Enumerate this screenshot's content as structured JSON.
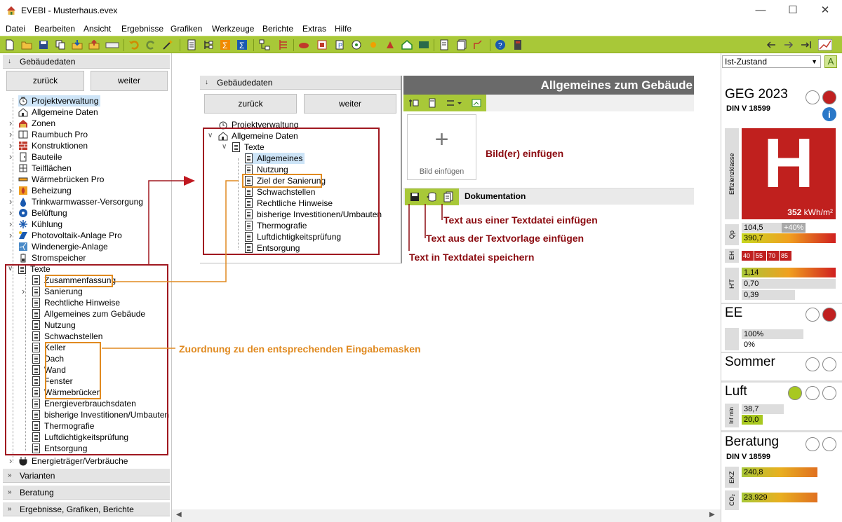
{
  "window": {
    "title": "EVEBI - Musterhaus.evex"
  },
  "menu": [
    "Datei",
    "Bearbeiten",
    "Ansicht",
    "Ergebnisse",
    "Grafiken",
    "Werkzeuge",
    "Berichte",
    "Extras",
    "Hilfe"
  ],
  "left": {
    "header": "Gebäudedaten",
    "back": "zurück",
    "next": "weiter",
    "tree": {
      "projekt": "Projektverwaltung",
      "allgemein": "Allgemeine Daten",
      "zonen": "Zonen",
      "raumbuch": "Raumbuch Pro",
      "konstruktionen": "Konstruktionen",
      "bauteile": "Bauteile",
      "teilflaechen": "Teilflächen",
      "waermebruecken": "Wärmebrücken Pro",
      "beheizung": "Beheizung",
      "trinkwarm": "Trinkwarmwasser-Versorgung",
      "belueftung": "Belüftung",
      "kuehlung": "Kühlung",
      "pv": "Photovoltaik-Anlage Pro",
      "wind": "Windenergie-Anlage",
      "strom": "Stromspeicher",
      "texte": "Texte",
      "texte_items": [
        "Zusammenfassung",
        "Sanierung",
        "Rechtliche Hinweise",
        "Allgemeines zum Gebäude",
        "Nutzung",
        "Schwachstellen",
        "Keller",
        "Dach",
        "Wand",
        "Fenster",
        "Wärmebrücken",
        "Energieverbrauchsdaten",
        "bisherige Investitionen/Umbauten",
        "Thermografie",
        "Luftdichtigkeitsprüfung",
        "Entsorgung"
      ],
      "energietraeger": "Energieträger/Verbräuche"
    },
    "sections": [
      "Varianten",
      "Beratung",
      "Ergebnisse, Grafiken, Berichte"
    ]
  },
  "inset": {
    "header": "Gebäudedaten",
    "back": "zurück",
    "next": "weiter",
    "tree": [
      "Projektverwaltung",
      "Allgemeine Daten",
      "Texte",
      "Allgemeines",
      "Nutzung",
      "Ziel der Sanierung",
      "Schwachstellen",
      "Rechtliche Hinweise",
      "bisherige Investitionen/Umbauten",
      "Thermografie",
      "Luftdichtigkeitsprüfung",
      "Entsorgung"
    ],
    "panel_title": "Allgemeines zum Gebäude",
    "add_image": "Bild einfügen",
    "add_image_plus": "+",
    "doc_label": "Dokumentation"
  },
  "annotations": {
    "bild": "Bild(er) einfügen",
    "textdatei": "Text aus einer Textdatei einfügen",
    "textvorlage": "Text aus der Textvorlage einfügen",
    "speichern": "Text in Textdatei speichern",
    "zuordnung": "Zuordnung zu den entsprechenden Eingabemasken"
  },
  "right": {
    "state": "Ist-Zustand",
    "state_btn": "A",
    "geg": "GEG 2023",
    "din": "DIN V 18599",
    "effizienz_label": "Effizienzklasse",
    "grade": "H",
    "kwh": "352",
    "kwh_unit": "kWh/m²",
    "qp_label": "Qp",
    "qp1": "104,5",
    "qp1b": "+40%",
    "qp2": "390,7",
    "eh_label": "EH",
    "eh": [
      "40",
      "55",
      "70",
      "85"
    ],
    "ht_label": "H'T",
    "ht": [
      "1,14",
      "0,70",
      "0,39"
    ],
    "ee": "EE",
    "ee1": "100%",
    "ee2": "0%",
    "sommer": "Sommer",
    "luft": "Luft",
    "inf_label": "Inf min",
    "inf1": "38,7",
    "inf2": "20,0",
    "beratung": "Beratung",
    "din2": "DIN V 18599",
    "ekz_label": "EKZ",
    "ekz": "240,8",
    "co2_label": "CO₂",
    "co2": "23.929"
  },
  "colors": {
    "toolbar": "#a8c838",
    "highlight_red": "#a01820",
    "highlight_orange": "#e08a20",
    "annotation_red": "#8b0b10",
    "annotation_orange": "#e08a20"
  }
}
